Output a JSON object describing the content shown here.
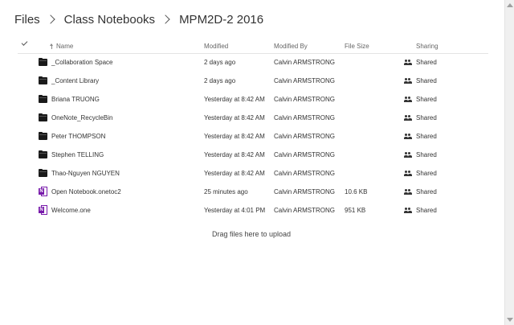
{
  "breadcrumb": {
    "items": [
      "Files",
      "Class Notebooks",
      "MPM2D-2 2016"
    ]
  },
  "columns": {
    "name": "Name",
    "modified": "Modified",
    "modified_by": "Modified By",
    "file_size": "File Size",
    "sharing": "Sharing"
  },
  "rows": [
    {
      "type": "folder",
      "icon": "folder-icon",
      "name": "_Collaboration Space",
      "modified": "2 days ago",
      "modified_by": "Calvin ARMSTRONG",
      "file_size": "",
      "sharing": "Shared"
    },
    {
      "type": "folder",
      "icon": "folder-icon",
      "name": "_Content Library",
      "modified": "2 days ago",
      "modified_by": "Calvin ARMSTRONG",
      "file_size": "",
      "sharing": "Shared"
    },
    {
      "type": "folder",
      "icon": "folder-icon",
      "name": "Briana TRUONG",
      "modified": "Yesterday at 8:42 AM",
      "modified_by": "Calvin ARMSTRONG",
      "file_size": "",
      "sharing": "Shared"
    },
    {
      "type": "folder",
      "icon": "folder-icon",
      "name": "OneNote_RecycleBin",
      "modified": "Yesterday at 8:42 AM",
      "modified_by": "Calvin ARMSTRONG",
      "file_size": "",
      "sharing": "Shared"
    },
    {
      "type": "folder",
      "icon": "folder-icon",
      "name": "Peter THOMPSON",
      "modified": "Yesterday at 8:42 AM",
      "modified_by": "Calvin ARMSTRONG",
      "file_size": "",
      "sharing": "Shared"
    },
    {
      "type": "folder",
      "icon": "folder-icon",
      "name": "Stephen TELLING",
      "modified": "Yesterday at 8:42 AM",
      "modified_by": "Calvin ARMSTRONG",
      "file_size": "",
      "sharing": "Shared"
    },
    {
      "type": "folder",
      "icon": "folder-icon",
      "name": "Thao-Nguyen NGUYEN",
      "modified": "Yesterday at 8:42 AM",
      "modified_by": "Calvin ARMSTRONG",
      "file_size": "",
      "sharing": "Shared"
    },
    {
      "type": "onenote",
      "icon": "onenote-icon",
      "name": "Open Notebook.onetoc2",
      "modified": "25 minutes ago",
      "modified_by": "Calvin ARMSTRONG",
      "file_size": "10.6 KB",
      "sharing": "Shared"
    },
    {
      "type": "onenote",
      "icon": "onenote-icon",
      "name": "Welcome.one",
      "modified": "Yesterday at 4:01 PM",
      "modified_by": "Calvin ARMSTRONG",
      "file_size": "951 KB",
      "sharing": "Shared"
    }
  ],
  "drop_hint": "Drag files here to upload",
  "icons": {
    "select_all": "checkmark-icon",
    "sort": "sort-up-arrow-icon",
    "share": "people-icon",
    "breadcrumb_separator": "chevron-right-icon"
  },
  "colors": {
    "onenote_purple": "#7719aa",
    "text": "#333333",
    "header_text": "#666666"
  }
}
